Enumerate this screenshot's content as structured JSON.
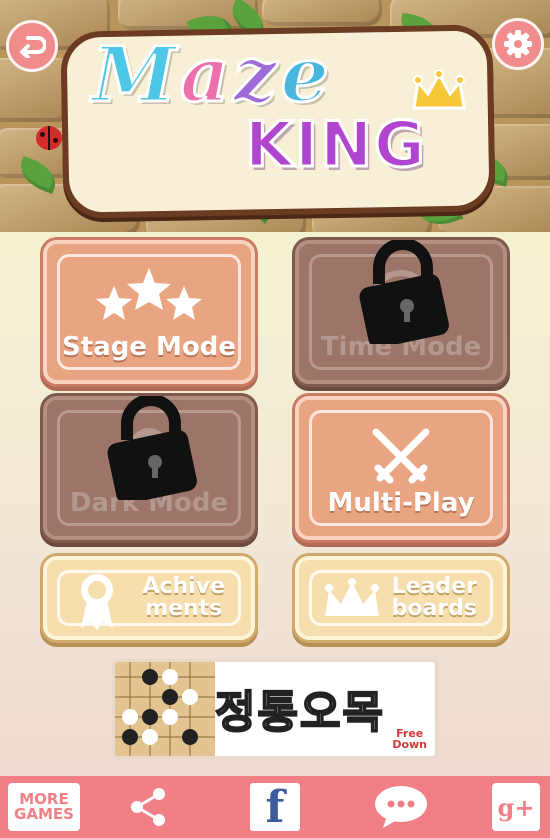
{
  "logo": {
    "line1": "Maze",
    "line2": "KING"
  },
  "header": {
    "back_icon": "back-arrow-icon",
    "settings_icon": "gear-icon"
  },
  "modes": [
    {
      "label": "Stage Mode",
      "icon": "stars-icon",
      "locked": false
    },
    {
      "label": "Time Mode",
      "icon": "clock-icon",
      "locked": true
    },
    {
      "label": "Dark Mode",
      "icon": "bulb-icon",
      "locked": true
    },
    {
      "label": "Multi-Play",
      "icon": "crossed-swords-icon",
      "locked": false
    }
  ],
  "secondary": [
    {
      "label_line1": "Achive",
      "label_line2": "ments",
      "icon": "medal-icon"
    },
    {
      "label_line1": "Leader",
      "label_line2": "boards",
      "icon": "crown-icon"
    }
  ],
  "banner": {
    "title": "정통오목",
    "free_line1": "Free",
    "free_line2": "Down"
  },
  "bottom_bar": {
    "more_games_line1": "MORE",
    "more_games_line2": "GAMES",
    "share_icon": "share-icon",
    "facebook_label": "f",
    "chat_icon": "chat-bubble-icon",
    "gplus_label": "g+"
  },
  "colors": {
    "accent": "#f07f86",
    "tile_active": "#e9a482",
    "tile_locked": "#9c7468",
    "tile_small": "#f6dfac",
    "king": "#b046d0"
  }
}
